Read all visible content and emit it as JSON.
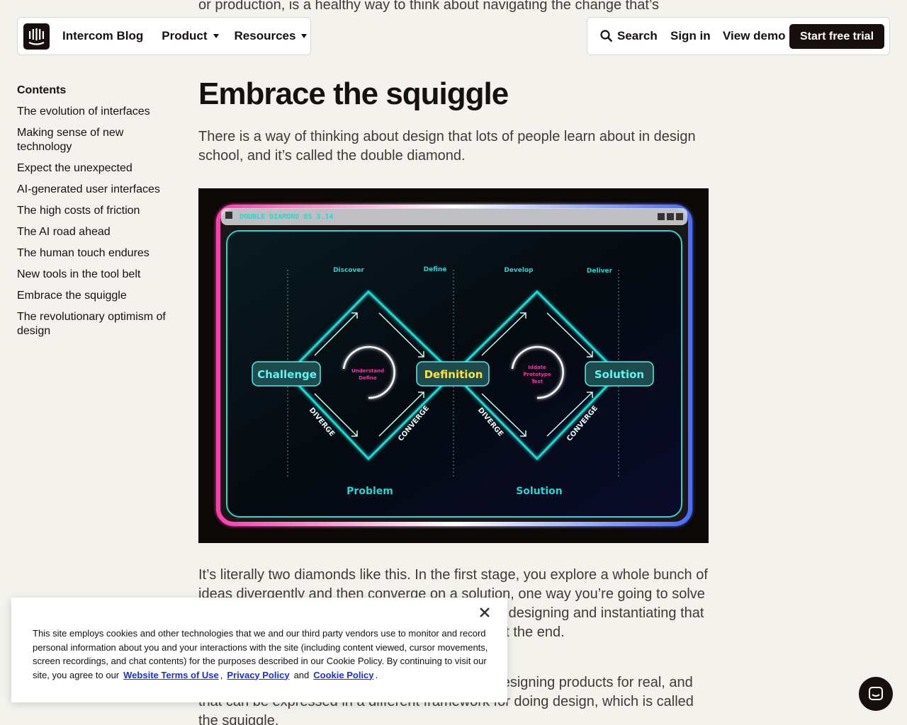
{
  "nav": {
    "brand": "Intercom Blog",
    "product": "Product",
    "resources": "Resources",
    "search": "Search",
    "sign_in": "Sign in",
    "view_demo": "View demo",
    "start_trial": "Start free trial"
  },
  "toc": {
    "title": "Contents",
    "items": [
      "The evolution of interfaces",
      "Making sense of new technology",
      "Expect the unexpected",
      "AI-generated user interfaces",
      "The high costs of friction",
      "The AI road ahead",
      "The human touch endures",
      "New tools in the tool belt",
      "Embrace the squiggle",
      "The revolutionary optimism of design"
    ]
  },
  "article": {
    "top_cut": "or production, is a healthy way to think about navigating the change that’s",
    "heading": "Embrace the squiggle",
    "p1": "There is a way of thinking about design that lots of people learn about in design school, and it’s called the double diamond.",
    "p2": "It’s literally two diamonds like this. In the first stage, you explore a whole bunch of ideas divergently and then converge on a solution, one way you’re going to solve the problem. Then you go through the process of designing and instantiating that solution, and hopefully, you’ve got your product at the end.",
    "p3": "But that’s not always how it works when you’re designing products for real, and that can be expressed in a different framework for doing design, which is called the squiggle."
  },
  "figure": {
    "window_title": "DOUBLE DIAMOND OS 3.14",
    "phases": [
      "Discover",
      "Define",
      "Develop",
      "Deliver"
    ],
    "nodes": [
      "Challenge",
      "Definition",
      "Solution"
    ],
    "loop1": [
      "Understand",
      "Define"
    ],
    "loop2": [
      "Iddate",
      "Prototype",
      "Test"
    ],
    "diverge": "DIVERGE",
    "converge": "CONVERGE",
    "bottom_left": "Problem",
    "bottom_right": "Solution"
  },
  "cookie": {
    "text": "This site employs cookies and other technologies that we and our third party vendors use to monitor and record personal information about you and your interactions with the site (including content viewed, cursor movements, screen recordings, and chat contents) for the purposes described in our Cookie Policy. By continuing to visit our site, you agree to our",
    "link1": "Website Terms of Use",
    "comma": ",",
    "link2": "Privacy Policy",
    "and": "and",
    "link3": "Cookie Policy",
    "period": "."
  },
  "colors": {
    "background": "#f3f2ec",
    "ink": "#17100e",
    "neon_cyan": "#1fd6d0",
    "neon_pink": "#ff2fa8",
    "neon_yellow": "#ffe23a",
    "link_blue": "#1a2fd6"
  }
}
